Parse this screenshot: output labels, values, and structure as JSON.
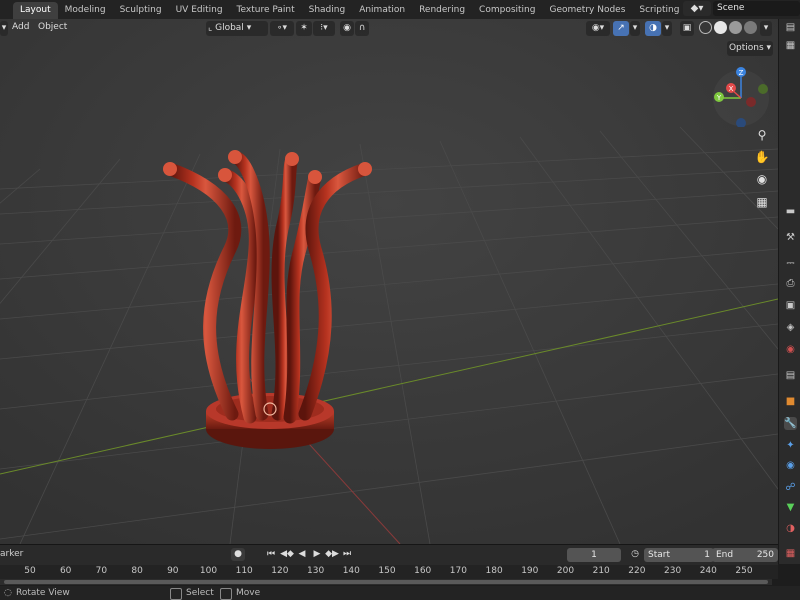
{
  "workspace_tabs": [
    "Layout",
    "Modeling",
    "Sculpting",
    "UV Editing",
    "Texture Paint",
    "Shading",
    "Animation",
    "Rendering",
    "Compositing",
    "Geometry Nodes",
    "Scripting"
  ],
  "add_tab_symbol": "+",
  "scene": {
    "icon": "scene-icon",
    "name": "Scene"
  },
  "viewport_header": {
    "add_menu": "Add",
    "object_menu": "Object",
    "transform_orientation": "Global",
    "options_label": "Options"
  },
  "gizmo_axes": {
    "x": "X",
    "y": "Y",
    "z": "Z",
    "x_color": "#e24a4a",
    "y_color": "#7fc93f",
    "z_color": "#3b84e0"
  },
  "model": {
    "description": "red bent tube sculpture",
    "color": "#9a2a1c"
  },
  "timeline": {
    "marker_label": "arker",
    "current_frame": "1",
    "start_label": "Start",
    "start_value": "1",
    "end_label": "End",
    "end_value": "250",
    "ruler_ticks": [
      "50",
      "60",
      "70",
      "80",
      "90",
      "100",
      "110",
      "120",
      "130",
      "140",
      "150",
      "160",
      "170",
      "180",
      "190",
      "200",
      "210",
      "220",
      "230",
      "240",
      "250"
    ]
  },
  "status_bar": {
    "rotate_view": "Rotate View",
    "select": "Select",
    "move": "Move"
  },
  "colors": {
    "accent": "#4772b3",
    "background": "#3a3a3a",
    "grid_x_axis": "#8a3a3a",
    "grid_y_axis": "#6a8a2a"
  }
}
